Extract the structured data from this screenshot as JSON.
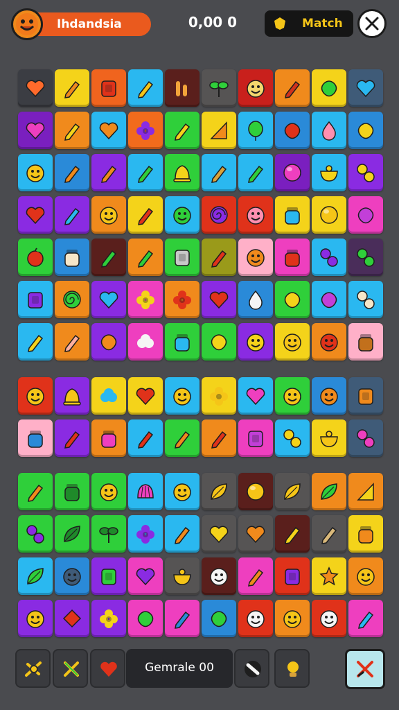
{
  "header": {
    "player_name": "Ihdandsia",
    "score": "0,00 0",
    "match_label": "Match"
  },
  "footer": {
    "game_label": "Gemrale 00"
  },
  "colors": {
    "background": "#4a4b4f",
    "header_pill": "#ea5a1e",
    "match_text": "#f5c518"
  },
  "board": {
    "sections": [
      {
        "rows": [
          [
            [
              "#3b3d43",
              "heart",
              "#ff6a2b"
            ],
            [
              "#f4d31a",
              "pencil",
              "#f08a1c"
            ],
            [
              "#f0641e",
              "square",
              "#e0321a"
            ],
            [
              "#2ab8f0",
              "pencil",
              "#f5c518"
            ],
            [
              "#5a1f1c",
              "bars",
              "#f2a33a"
            ],
            [
              "#565454",
              "sprout",
              "#2fcf3a"
            ],
            [
              "#c9201c",
              "face",
              "#f5d76e"
            ],
            [
              "#f08a1c",
              "pencil",
              "#d0321c"
            ],
            [
              "#f4d31a",
              "blob",
              "#2fcf3a"
            ],
            [
              "#3f5b78",
              "heart",
              "#2ab8f0"
            ]
          ],
          [
            [
              "#7a1fbf",
              "heart",
              "#ee3fbf"
            ],
            [
              "#f08a1c",
              "pencil",
              "#f4d31a"
            ],
            [
              "#2ab8f0",
              "heart",
              "#f08a1c"
            ],
            [
              "#f26b1c",
              "flower",
              "#8a2be2"
            ],
            [
              "#2fcf3a",
              "pencil",
              "#f4d31a"
            ],
            [
              "#f4d31a",
              "triangle",
              "#f08a1c"
            ],
            [
              "#2ab8f0",
              "balloon",
              "#2fcf3a"
            ],
            [
              "#2a8ad8",
              "blob",
              "#e0321a"
            ],
            [
              "#2ab8f0",
              "drop",
              "#ff8fb0"
            ],
            [
              "#2a8ad8",
              "blob",
              "#f4d31a"
            ]
          ],
          [
            [
              "#2ab8f0",
              "face",
              "#f5c518"
            ],
            [
              "#2a8ad8",
              "pencil",
              "#f08a1c"
            ],
            [
              "#8a2be2",
              "pencil",
              "#f08a1c"
            ],
            [
              "#2ab8f0",
              "pencil",
              "#2fcf3a"
            ],
            [
              "#2fcf3a",
              "bell",
              "#f4d31a"
            ],
            [
              "#2ab8f0",
              "pencil",
              "#d9a23a"
            ],
            [
              "#2ab8f0",
              "pencil",
              "#2fcf3a"
            ],
            [
              "#7a1fbf",
              "circle",
              "#ee3fbf"
            ],
            [
              "#2ab8f0",
              "bowl",
              "#f4d31a"
            ],
            [
              "#8a2be2",
              "dots",
              "#f4d31a"
            ]
          ],
          [
            [
              "#8a2be2",
              "heart",
              "#e0321a"
            ],
            [
              "#8a2be2",
              "pencil",
              "#2ab8f0"
            ],
            [
              "#f08a1c",
              "face",
              "#f5c518"
            ],
            [
              "#f4d31a",
              "pencil",
              "#e0321a"
            ],
            [
              "#2ab8f0",
              "face",
              "#2fcf3a"
            ],
            [
              "#e0321a",
              "spiral",
              "#8a2be2"
            ],
            [
              "#e0321a",
              "face",
              "#ff8fb0"
            ],
            [
              "#f4d31a",
              "jar",
              "#2ab8f0"
            ],
            [
              "#f4d31a",
              "circle",
              "#f5c518"
            ],
            [
              "#ee3fbf",
              "blob",
              "#c23fd8"
            ]
          ],
          [
            [
              "#2fcf3a",
              "apple",
              "#e0321a"
            ],
            [
              "#2a8ad8",
              "jar",
              "#f5e6c8"
            ],
            [
              "#5a1f1c",
              "pencil",
              "#2fcf3a"
            ],
            [
              "#f08a1c",
              "pencil",
              "#2fcf3a"
            ],
            [
              "#2fcf3a",
              "square",
              "#c8c8c8"
            ],
            [
              "#9a9a1a",
              "pencil",
              "#e0321a"
            ],
            [
              "#ffb0c8",
              "face",
              "#f08a1c"
            ],
            [
              "#ee3fbf",
              "jar",
              "#e0321a"
            ],
            [
              "#2ab8f0",
              "dots",
              "#8a2be2"
            ],
            [
              "#4a2d5a",
              "dots",
              "#2fcf3a"
            ]
          ],
          [
            [
              "#2ab8f0",
              "square",
              "#8a2be2"
            ],
            [
              "#f08a1c",
              "spiral",
              "#2fcf3a"
            ],
            [
              "#8a2be2",
              "heart",
              "#2ab8f0"
            ],
            [
              "#ee3fbf",
              "flower",
              "#f4d31a"
            ],
            [
              "#f08a1c",
              "flower",
              "#e0321a"
            ],
            [
              "#8a2be2",
              "heart",
              "#e0321a"
            ],
            [
              "#2a8ad8",
              "drop",
              "#f5f5f5"
            ],
            [
              "#2fcf3a",
              "blob",
              "#f4d31a"
            ],
            [
              "#2ab8f0",
              "blob",
              "#c23fd8"
            ],
            [
              "#2ab8f0",
              "dots",
              "#f5e6c8"
            ]
          ],
          [
            [
              "#2ab8f0",
              "pencil",
              "#f4d31a"
            ],
            [
              "#f08a1c",
              "pencil",
              "#ffb0a0"
            ],
            [
              "#8a2be2",
              "blob",
              "#f08a1c"
            ],
            [
              "#ee3fbf",
              "cloud",
              "#f5f5f5"
            ],
            [
              "#2fcf3a",
              "jar",
              "#2ab8f0"
            ],
            [
              "#2fcf3a",
              "blob",
              "#f4d31a"
            ],
            [
              "#8a2be2",
              "face",
              "#f4d31a"
            ],
            [
              "#f4d31a",
              "face",
              "#f5c518"
            ],
            [
              "#f08a1c",
              "face",
              "#e0321a"
            ],
            [
              "#ffb0c8",
              "jar",
              "#c2701c"
            ]
          ]
        ]
      },
      {
        "rows": [
          [
            [
              "#e0321a",
              "face",
              "#f5c518"
            ],
            [
              "#8a2be2",
              "bell",
              "#f5c518"
            ],
            [
              "#f4d31a",
              "cloud",
              "#2ab8f0"
            ],
            [
              "#f4d31a",
              "heart",
              "#e0321a"
            ],
            [
              "#2ab8f0",
              "face",
              "#f5c518"
            ],
            [
              "#f4d31a",
              "flower",
              "#f5c518"
            ],
            [
              "#2ab8f0",
              "heart",
              "#ee3fbf"
            ],
            [
              "#2fcf3a",
              "face",
              "#f5c518"
            ],
            [
              "#2a8ad8",
              "face",
              "#f08a1c"
            ],
            [
              "#3f5b78",
              "square",
              "#f08a1c"
            ]
          ],
          [
            [
              "#ffb0c8",
              "jar",
              "#2a8ad8"
            ],
            [
              "#8a2be2",
              "pencil",
              "#e0321a"
            ],
            [
              "#f08a1c",
              "jar",
              "#ee3fbf"
            ],
            [
              "#2ab8f0",
              "pencil",
              "#e0321a"
            ],
            [
              "#2fcf3a",
              "pencil",
              "#f08a1c"
            ],
            [
              "#f08a1c",
              "pencil",
              "#e0321a"
            ],
            [
              "#ee3fbf",
              "square",
              "#c23fd8"
            ],
            [
              "#2ab8f0",
              "dots",
              "#f4d31a"
            ],
            [
              "#f4d31a",
              "bowl",
              "#f5c518"
            ],
            [
              "#3f5b78",
              "dots",
              "#ee3fbf"
            ]
          ]
        ]
      },
      {
        "rows": [
          [
            [
              "#2fcf3a",
              "pencil",
              "#f08a1c"
            ],
            [
              "#2fcf3a",
              "jar",
              "#1f8a2a"
            ],
            [
              "#2fcf3a",
              "face",
              "#f5c518"
            ],
            [
              "#2ab8f0",
              "shell",
              "#ee3fbf"
            ],
            [
              "#2ab8f0",
              "face",
              "#f5c518"
            ],
            [
              "#565454",
              "leaf",
              "#f5c518"
            ],
            [
              "#5a1f1c",
              "circle",
              "#f5c518"
            ],
            [
              "#565454",
              "leaf",
              "#f5c518"
            ],
            [
              "#f08a1c",
              "leaf",
              "#2fcf3a"
            ],
            [
              "#f08a1c",
              "triangle",
              "#f4d31a"
            ]
          ],
          [
            [
              "#2fcf3a",
              "dots",
              "#8a2be2"
            ],
            [
              "#2fcf3a",
              "leaf",
              "#1f8a2a"
            ],
            [
              "#2fcf3a",
              "sprout",
              "#1f8a2a"
            ],
            [
              "#2ab8f0",
              "flower",
              "#8a2be2"
            ],
            [
              "#2ab8f0",
              "pencil",
              "#f08a1c"
            ],
            [
              "#565454",
              "heart",
              "#f4d31a"
            ],
            [
              "#565454",
              "heart",
              "#f08a1c"
            ],
            [
              "#5a1f1c",
              "pencil",
              "#f4d31a"
            ],
            [
              "#565454",
              "pencil",
              "#d9b87a"
            ],
            [
              "#f4d31a",
              "jar",
              "#f08a1c"
            ]
          ],
          [
            [
              "#2ab8f0",
              "leaf",
              "#2fcf3a"
            ],
            [
              "#2a8ad8",
              "face",
              "#3f5b78"
            ],
            [
              "#8a2be2",
              "square",
              "#2fcf3a"
            ],
            [
              "#ee3fbf",
              "heart",
              "#8a2be2"
            ],
            [
              "#565454",
              "bowl",
              "#f5c518"
            ],
            [
              "#5a1f1c",
              "face",
              "#f5f5f5"
            ],
            [
              "#ee3fbf",
              "pencil",
              "#f08a1c"
            ],
            [
              "#e0321a",
              "square",
              "#8a2be2"
            ],
            [
              "#f4d31a",
              "star",
              "#f08a1c"
            ],
            [
              "#f08a1c",
              "face",
              "#f5c518"
            ]
          ],
          [
            [
              "#8a2be2",
              "face",
              "#f5c518"
            ],
            [
              "#8a2be2",
              "diamond",
              "#e0321a"
            ],
            [
              "#8a2be2",
              "flower",
              "#f4d31a"
            ],
            [
              "#ee3fbf",
              "blob",
              "#2fcf3a"
            ],
            [
              "#ee3fbf",
              "pencil",
              "#2a8ad8"
            ],
            [
              "#2a8ad8",
              "blob",
              "#2fcf3a"
            ],
            [
              "#e0321a",
              "face",
              "#f5f5f5"
            ],
            [
              "#f08a1c",
              "face",
              "#f5c518"
            ],
            [
              "#e0321a",
              "face",
              "#f5f5f5"
            ],
            [
              "#ee3fbf",
              "pencil",
              "#2ab8f0"
            ]
          ]
        ]
      }
    ]
  },
  "toolbar": {
    "buttons": [
      {
        "name": "trophy-button",
        "icon": "trophy-icon"
      },
      {
        "name": "cross-button",
        "icon": "cross-icon"
      },
      {
        "name": "heart-button",
        "icon": "heart-icon"
      },
      {
        "name": "slash-button",
        "icon": "slash-icon"
      },
      {
        "name": "hint-button",
        "icon": "bulb-icon"
      },
      {
        "name": "shuffle-button",
        "icon": "shuffle-icon"
      }
    ]
  }
}
